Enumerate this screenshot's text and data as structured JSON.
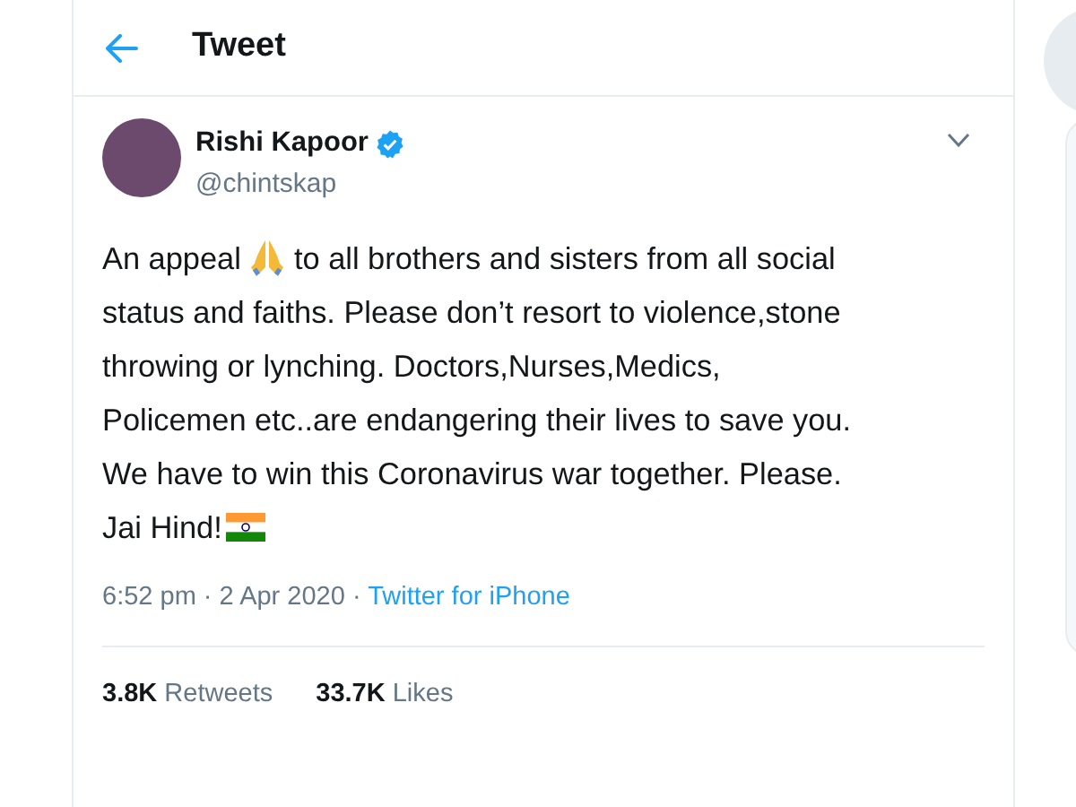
{
  "header": {
    "title": "Tweet"
  },
  "author": {
    "name": "Rishi Kapoor",
    "verified": true,
    "handle": "@chintskap"
  },
  "body_lines": [
    [
      {
        "kind": "text",
        "text": "An appeal "
      },
      {
        "kind": "folded-hands"
      },
      {
        "kind": "text",
        "text": " to all brothers and sisters from all social"
      }
    ],
    [
      {
        "kind": "text",
        "text": "status and faiths. Please don’t resort to violence,stone"
      }
    ],
    [
      {
        "kind": "text",
        "text": "throwing or lynching. Doctors,Nurses,Medics,"
      }
    ],
    [
      {
        "kind": "text",
        "text": "Policemen etc..are endangering their lives to save you."
      }
    ],
    [
      {
        "kind": "text",
        "text": "We have to win this Coronavirus war together. Please."
      }
    ],
    [
      {
        "kind": "text",
        "text": "Jai Hind!"
      },
      {
        "kind": "flag"
      }
    ]
  ],
  "meta": {
    "time": "6:52 pm · 2 Apr 2020 ·",
    "source": "Twitter for iPhone"
  },
  "stats": [
    {
      "count": "3.8K",
      "label": "Retweets"
    },
    {
      "count": "33.7K",
      "label": "Likes"
    }
  ]
}
